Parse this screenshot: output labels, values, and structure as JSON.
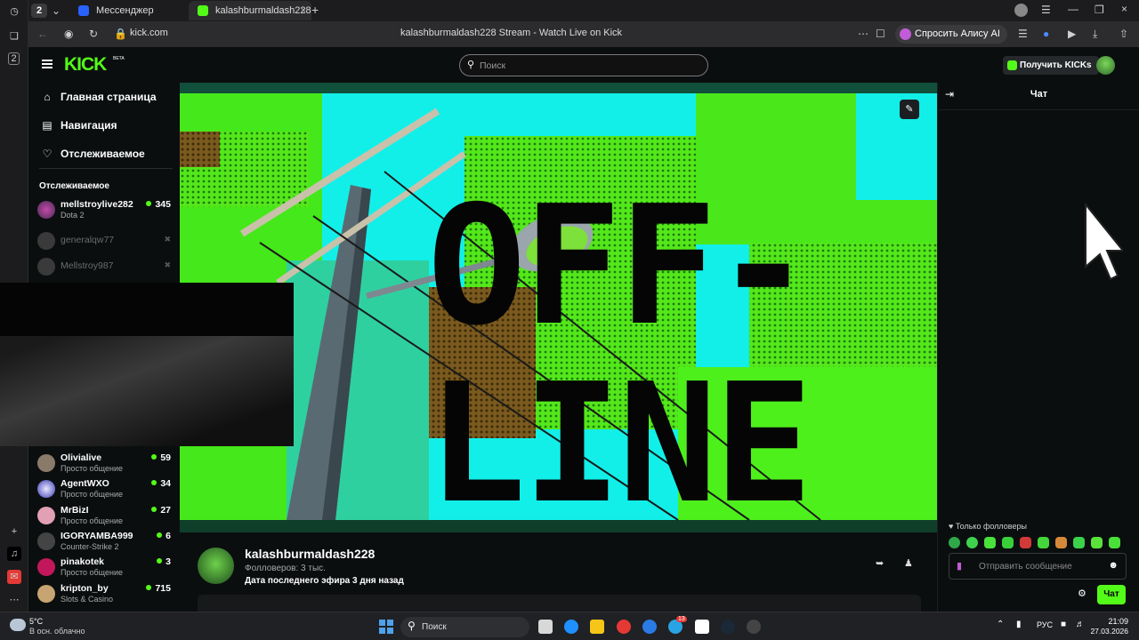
{
  "browser": {
    "tab_count": "2",
    "tabs": [
      {
        "label": "Мессенджер",
        "active": false
      },
      {
        "label": "kalashburmaldash228 S",
        "active": true
      }
    ],
    "url": "kick.com",
    "page_title": "kalashburmaldash228 Stream - Watch Live on Kick",
    "alice_label": "Спросить Алису AI"
  },
  "header": {
    "logo": "KICK",
    "logo_badge": "BETA",
    "search_placeholder": "Поиск",
    "get_kicks_label": "Получить KICKs"
  },
  "sidebar": {
    "nav": [
      {
        "label": "Главная страница",
        "icon": "home-icon"
      },
      {
        "label": "Навигация",
        "icon": "compass-icon"
      },
      {
        "label": "Отслеживаемое",
        "icon": "heart-icon"
      }
    ],
    "following_title": "Отслеживаемое",
    "following": [
      {
        "name": "mellstroylive282",
        "category": "Dota 2",
        "viewers": "345",
        "live": true
      },
      {
        "name": "generalqw77",
        "category": "",
        "viewers": "",
        "live": false
      },
      {
        "name": "Mellstroy987",
        "category": "",
        "viewers": "",
        "live": false
      },
      {
        "name": "Olivialive",
        "category": "Просто общение",
        "viewers": "59",
        "live": true
      },
      {
        "name": "AgentWXO",
        "category": "Просто общение",
        "viewers": "34",
        "live": true
      },
      {
        "name": "MrBizI",
        "category": "Просто общение",
        "viewers": "27",
        "live": true
      },
      {
        "name": "IGORYAMBA999",
        "category": "Counter-Strike 2",
        "viewers": "6",
        "live": true
      },
      {
        "name": "pinakotek",
        "category": "Просто общение",
        "viewers": "3",
        "live": true
      },
      {
        "name": "kripton_by",
        "category": "Slots & Casino",
        "viewers": "715",
        "live": true
      }
    ]
  },
  "player": {
    "offline_line1": "OFF-",
    "offline_line2": "LINE"
  },
  "channel": {
    "name": "kalashburmaldash228",
    "followers": "Фолловеров: 3 тыс.",
    "last_stream": "Дата последнего эфира 3 дня назад"
  },
  "chat": {
    "title": "Чат",
    "followers_only": "Только фолловеры",
    "input_placeholder": "Отправить сообщение",
    "send_label": "Чат"
  },
  "taskbar": {
    "weather_temp": "5°C",
    "weather_desc": "В осн. облачно",
    "search_label": "Поиск",
    "language": "РУС",
    "time": "21:09",
    "date": "27.03.2026",
    "badge_count": "13"
  },
  "colors": {
    "brand_green": "#53fc18",
    "background": "#0b0e0f",
    "offline_cyan": "#0df0f0"
  }
}
